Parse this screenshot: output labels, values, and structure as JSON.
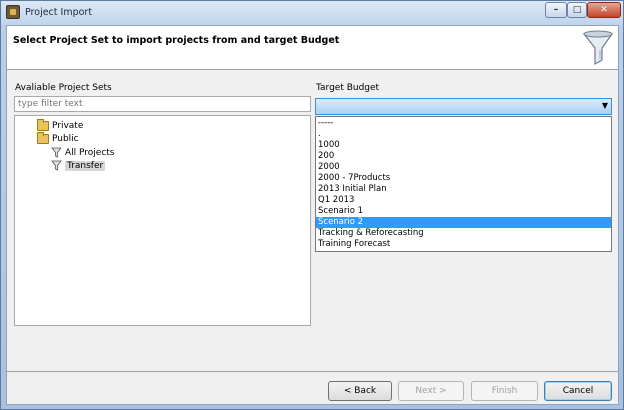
{
  "window": {
    "title": "Project Import",
    "icon": "app-icon",
    "controls": {
      "minimize": "–",
      "maximize": "□",
      "close": "✕"
    }
  },
  "banner": {
    "title": "Select Project Set to import projects from and target Budget",
    "icon": "funnel-wizard-icon"
  },
  "left": {
    "label": "Avaliable Project Sets",
    "filter_placeholder": "type filter text",
    "tree": [
      {
        "label": "Private",
        "icon": "folder-icon"
      },
      {
        "label": "Public",
        "icon": "folder-icon"
      },
      {
        "label": "All Projects",
        "icon": "filter-icon"
      },
      {
        "label": "Transfer",
        "icon": "filter-icon",
        "selected": true
      }
    ]
  },
  "right": {
    "label": "Target Budget",
    "selected_value": "",
    "options": [
      "-----",
      ".",
      "1000",
      "200",
      "2000",
      "2000 - 7Products",
      "2013 Initial Plan",
      "Q1 2013",
      "Scenario 1",
      "Scenario 2",
      "Tracking & Reforecasting",
      "Training Forecast"
    ],
    "highlighted_option": "Scenario 2"
  },
  "footer": {
    "back": "< Back",
    "next": "Next >",
    "finish": "Finish",
    "cancel": "Cancel"
  },
  "colors": {
    "selection": "#3399ff",
    "combo_focus": "#3b8fd4"
  }
}
